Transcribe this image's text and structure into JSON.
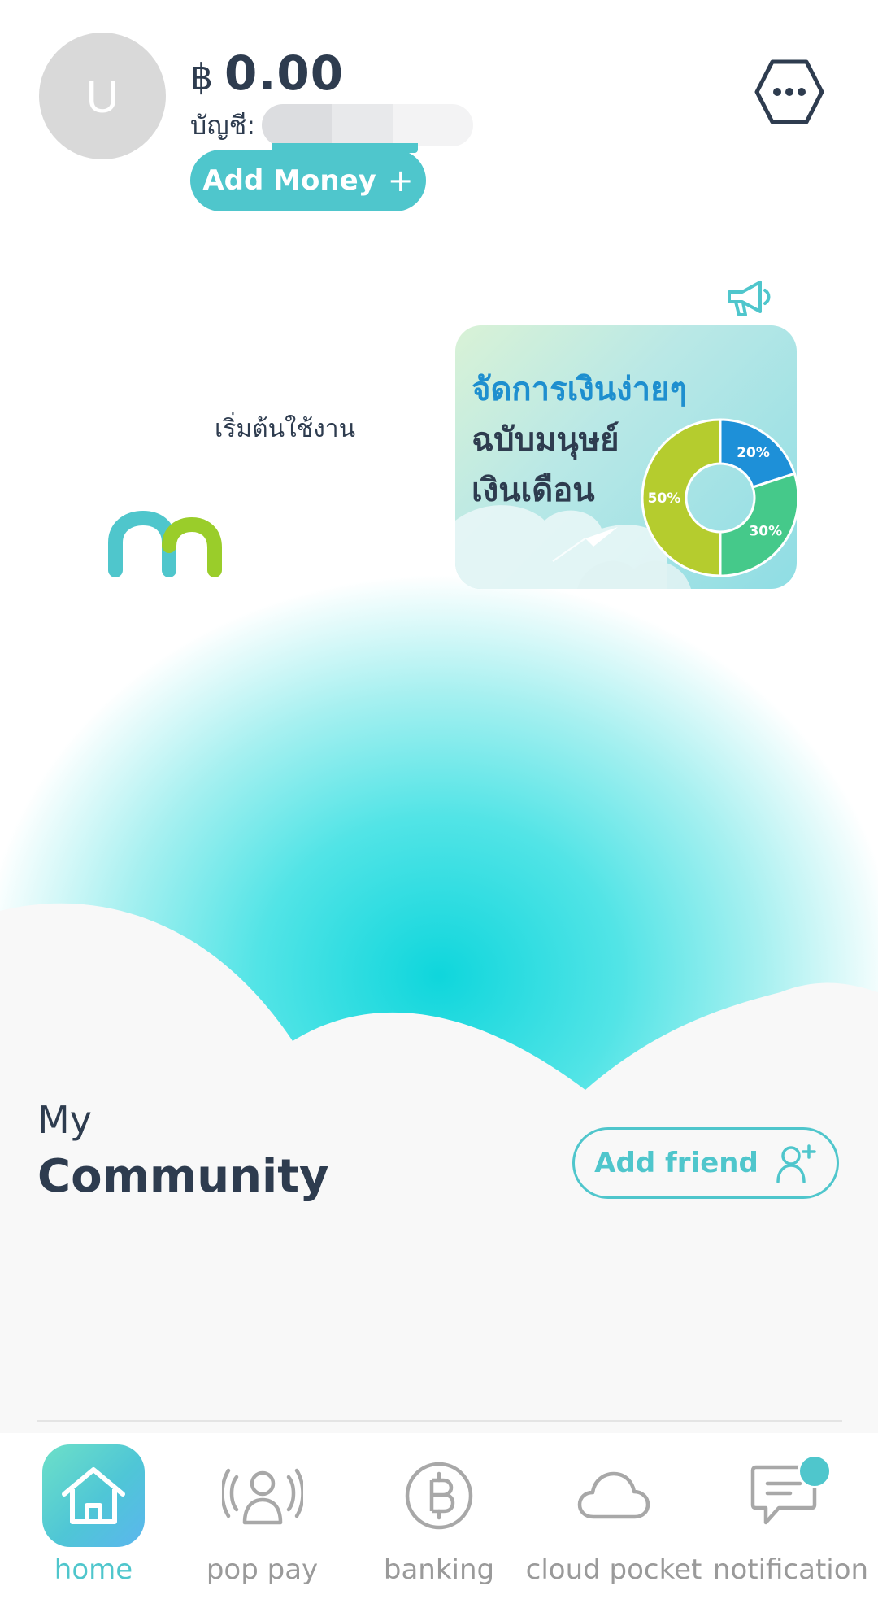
{
  "header": {
    "avatar_initial": "U",
    "currency_symbol": "฿",
    "balance": "0.00",
    "account_label": "บัญชี:",
    "add_money_label": "Add Money",
    "add_money_icon": "+"
  },
  "promo": {
    "line1": "จัดการเงินง่ายๆ",
    "line2": "ฉบับมนุษย์",
    "line3": "เงินเดือน",
    "segments": [
      {
        "label": "20%",
        "value": 20,
        "color": "#1e90d8"
      },
      {
        "label": "30%",
        "value": 30,
        "color": "#45c98a"
      },
      {
        "label": "50%",
        "value": 50,
        "color": "#b5cc2e"
      }
    ]
  },
  "start_label": "เริ่มต้นใช้งาน",
  "community": {
    "my_label": "My",
    "title": "Community",
    "add_friend_label": "Add friend"
  },
  "nav": {
    "items": [
      {
        "label": "home",
        "icon": "home-icon",
        "active": true
      },
      {
        "label": "pop pay",
        "icon": "pop-pay-icon",
        "active": false
      },
      {
        "label": "banking",
        "icon": "baht-icon",
        "active": false
      },
      {
        "label": "cloud pocket",
        "icon": "cloud-icon",
        "active": false
      },
      {
        "label": "notification",
        "icon": "chat-icon",
        "active": false
      }
    ]
  },
  "colors": {
    "accent": "#4fc6cc",
    "text": "#2e3c4f",
    "inactive": "#9a9a9a"
  }
}
